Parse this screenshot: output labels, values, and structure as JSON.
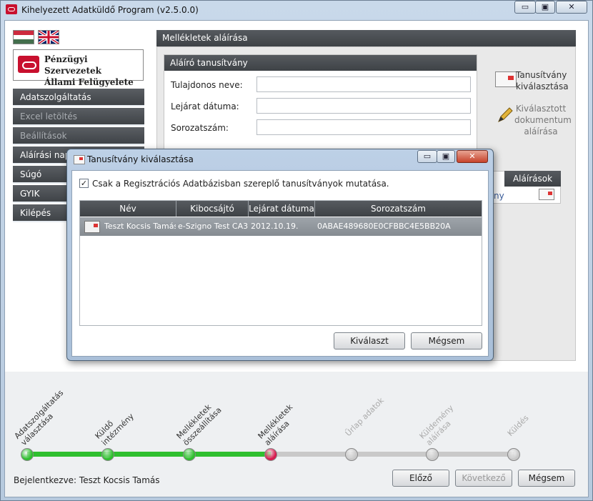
{
  "window": {
    "title": "Kihelyezett Adatküldő Program (v2.5.0.0)",
    "min_glyph": "▭",
    "max_glyph": "▣",
    "close_glyph": "✕"
  },
  "logo": {
    "line1": "Pénzügyi Szervezetek",
    "line2": "Állami Felügyelete"
  },
  "nav": [
    {
      "label": "Adatszolgáltatás"
    },
    {
      "label": "Excel letöltés"
    },
    {
      "label": "Beállítások"
    },
    {
      "label": "Aláírási napló"
    },
    {
      "label": "Súgó"
    },
    {
      "label": "GYIK"
    },
    {
      "label": "Kilépés"
    }
  ],
  "main": {
    "header": "Mellékletek aláírása",
    "signer_panel": {
      "title": "Aláíró tanusítvány",
      "fields": [
        {
          "label": "Tulajdonos neve:",
          "value": ""
        },
        {
          "label": "Lejárat dátuma:",
          "value": ""
        },
        {
          "label": "Sorozatszám:",
          "value": ""
        }
      ]
    },
    "actions": {
      "choose_cert": "Tanusítvány\nkiválasztása",
      "sign_selected": "Kiválasztott\ndokumentum\naláírása"
    },
    "table": {
      "col_signatures": "Aláírások",
      "row_fragment": "ny"
    }
  },
  "dialog": {
    "title": "Tanusítvány kiválasztása",
    "checkbox_label": "Csak a Regisztrációs Adatbázisban szereplő tanusítványok mutatása.",
    "checkbox_checked": true,
    "columns": [
      "Név",
      "Kibocsájtó",
      "Lejárat dátuma",
      "Sorozatszám"
    ],
    "rows": [
      [
        "Teszt Kocsis Tamás",
        "e-Szigno Test CA3",
        "2012.10.19.",
        "0ABAE489680E0CFBBC4E5BB20A"
      ]
    ],
    "ok_label": "Kiválaszt",
    "cancel_label": "Mégsem"
  },
  "steps": [
    {
      "label": "Adatszolgáltatás\nválasztása",
      "state": "done"
    },
    {
      "label": "Küldő\nintézmény",
      "state": "done"
    },
    {
      "label": "Mellékletek\nösszeállítása",
      "state": "done"
    },
    {
      "label": "Mellékletek\naláírása",
      "state": "current"
    },
    {
      "label": "Űrlap adatok",
      "state": "todo"
    },
    {
      "label": "Küldemény\naláírása",
      "state": "todo"
    },
    {
      "label": "Küldés",
      "state": "todo"
    }
  ],
  "footer": {
    "login_label": "Bejelentkezve:",
    "login_user": "Teszt Kocsis Tamás",
    "prev_label": "Előző",
    "next_label": "Következő",
    "cancel_label": "Mégsem"
  },
  "colors": {
    "accent_red": "#c8102e",
    "step_done": "#2fbf2f",
    "step_current": "#d81b4f",
    "step_todo": "#c9c9c9"
  }
}
